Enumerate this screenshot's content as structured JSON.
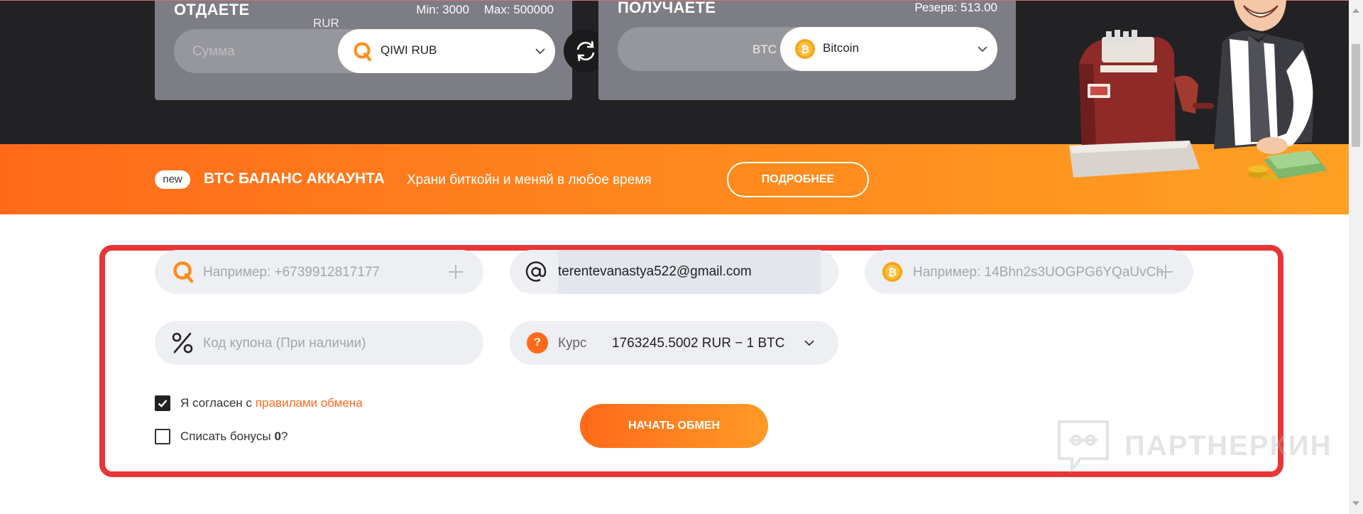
{
  "give_card": {
    "title": "ОТДАЕТЕ",
    "min": "Min: 3000",
    "max": "Max: 500000",
    "amount_placeholder": "Сумма",
    "currency_code": "RUR",
    "currency_name": "QIWI RUB",
    "currency_icon": "qiwi-icon"
  },
  "get_card": {
    "title": "ПОЛУЧАЕТЕ",
    "reserve": "Резерв: 513.00",
    "currency_code": "BTC",
    "currency_name": "Bitcoin",
    "currency_icon": "bitcoin-icon"
  },
  "banner": {
    "badge": "new",
    "title": "BTC БАЛАНС АККАУНТА",
    "subtitle": "Храни биткойн и меняй в любое время",
    "button": "ПОДРОБНЕЕ"
  },
  "form": {
    "phone_placeholder": "Например: +6739912817177",
    "email_value": "terentevanastya522@gmail.com",
    "wallet_placeholder": "Например: 14Bhn2s3UOGPG6YQaUvCh",
    "coupon_placeholder": "Код купона (При наличии)",
    "rate_badge": "?",
    "rate_label": "Курс",
    "rate_value": "1763245.5002 RUR − 1 BTC",
    "agree_prefix": "Я согласен с",
    "agree_link": "правилами обмена",
    "agree_checked": true,
    "bonus_prefix": "Списать бонусы",
    "bonus_value": "0",
    "bonus_suffix": "?",
    "bonus_checked": false,
    "submit": "НАЧАТЬ ОБМЕН"
  },
  "watermark": "ПАРТНЕРКИН",
  "colors": {
    "accent": "#ff6a1a",
    "dark_bg": "#222225",
    "card_bg": "#7d7d85",
    "highlight": "#e83535"
  }
}
